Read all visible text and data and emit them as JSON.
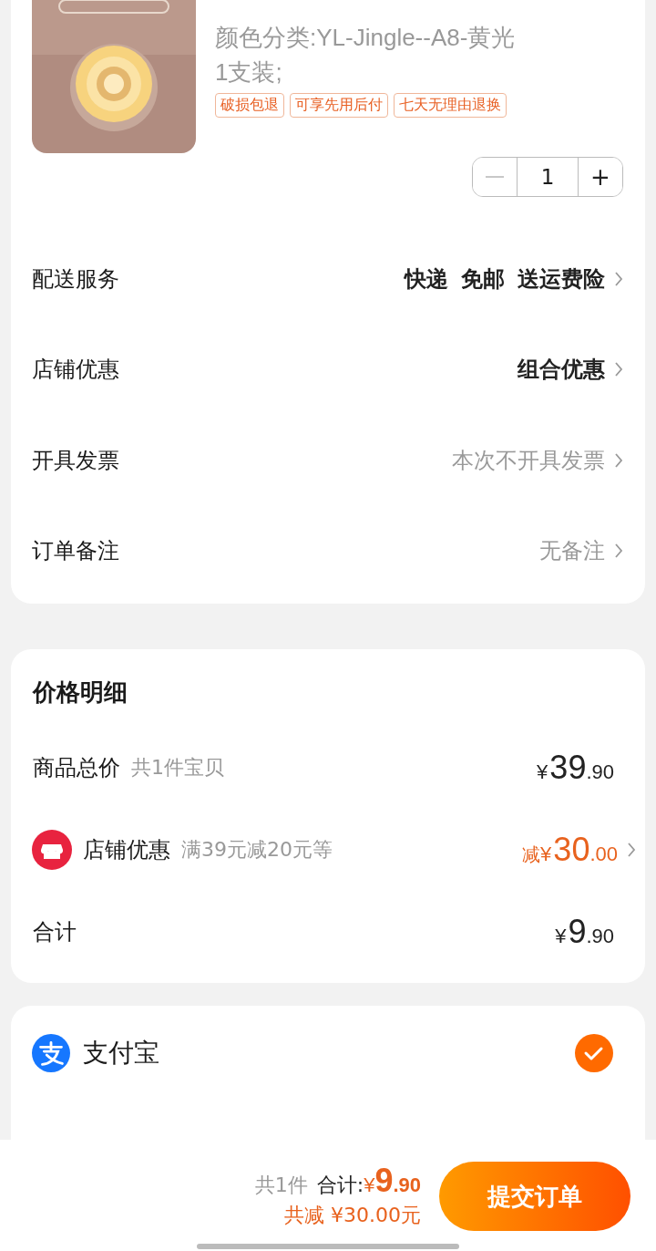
{
  "product": {
    "variant": "颜色分类:YL-Jingle--A8-黄光  1支装;",
    "tags": [
      "破损包退",
      "可享先用后付",
      "七天无理由退换"
    ],
    "quantity": "1",
    "minus_disabled": true,
    "plus": "+"
  },
  "services": [
    {
      "label": "配送服务",
      "values": [
        "快递",
        "免邮",
        "送运费险"
      ],
      "muted": false
    },
    {
      "label": "店铺优惠",
      "values": [
        "组合优惠"
      ],
      "muted": false
    },
    {
      "label": "开具发票",
      "values": [
        "本次不开具发票"
      ],
      "muted": true
    },
    {
      "label": "订单备注",
      "values": [
        "无备注"
      ],
      "muted": true
    }
  ],
  "price_detail": {
    "title": "价格明细",
    "rows": [
      {
        "kind": "total",
        "label": "商品总价",
        "note": "共1件宝贝",
        "currency": "¥",
        "int": "39",
        "dec": ".90"
      },
      {
        "kind": "discount",
        "label": "店铺优惠",
        "note": "满39元减20元等",
        "prefix": "减",
        "currency": "¥",
        "int": "30",
        "dec": ".00"
      },
      {
        "kind": "sum",
        "label": "合计",
        "currency": "¥",
        "int": "9",
        "dec": ".90"
      }
    ]
  },
  "payment": {
    "name": "支付宝",
    "selected": true
  },
  "footer": {
    "count": "共1件",
    "total_label": "合计:",
    "currency": "¥",
    "int": "9",
    "dec": ".90",
    "saved": "共减 ¥30.00元",
    "submit": "提交订单"
  }
}
